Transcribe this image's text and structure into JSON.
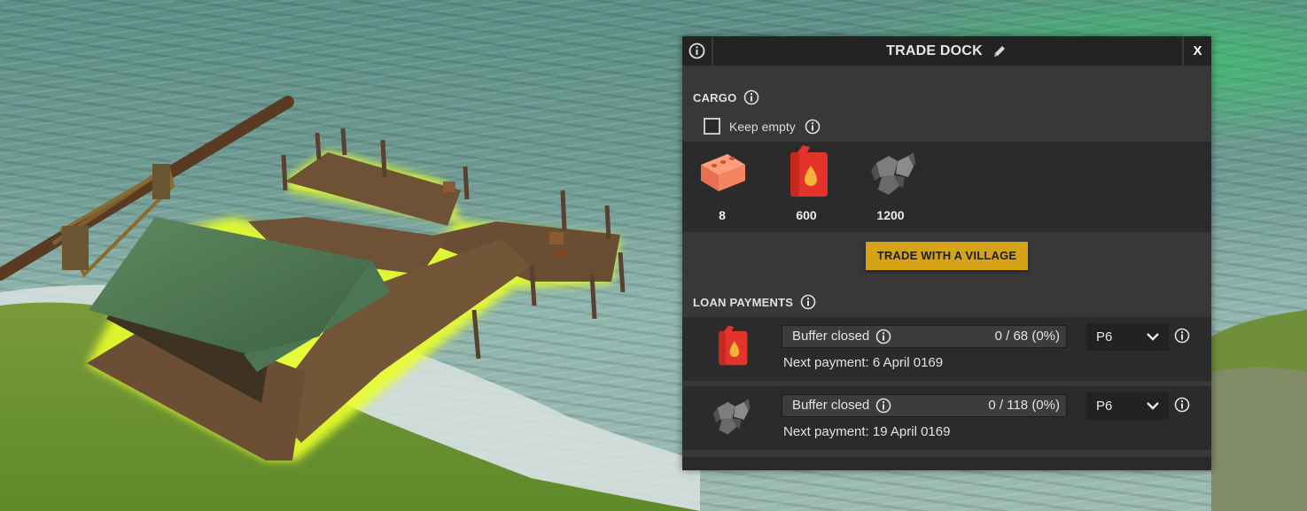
{
  "window": {
    "title": "TRADE DOCK",
    "close_label": "X"
  },
  "cargo": {
    "heading": "CARGO",
    "keep_empty_label": "Keep empty",
    "keep_empty_checked": false,
    "items": [
      {
        "icon": "brick-icon",
        "quantity": "8"
      },
      {
        "icon": "fuel-canister-icon",
        "quantity": "600"
      },
      {
        "icon": "rock-icon",
        "quantity": "1200"
      }
    ]
  },
  "trade_button_label": "TRADE WITH A VILLAGE",
  "loan_payments": {
    "heading": "LOAN PAYMENTS",
    "rows": [
      {
        "icon": "fuel-canister-icon",
        "buffer_label": "Buffer closed",
        "buffer_value": "0 / 68 (0%)",
        "next_payment": "Next payment: 6 April 0169",
        "priority": "P6"
      },
      {
        "icon": "rock-icon",
        "buffer_label": "Buffer closed",
        "buffer_value": "0 / 118 (0%)",
        "next_payment": "Next payment: 19 April 0169",
        "priority": "P6"
      }
    ]
  },
  "colors": {
    "accent_button": "#d6a316",
    "panel_bg": "#383838",
    "titlebar_bg": "#232323",
    "selection_glow": "#e8ff2a"
  }
}
